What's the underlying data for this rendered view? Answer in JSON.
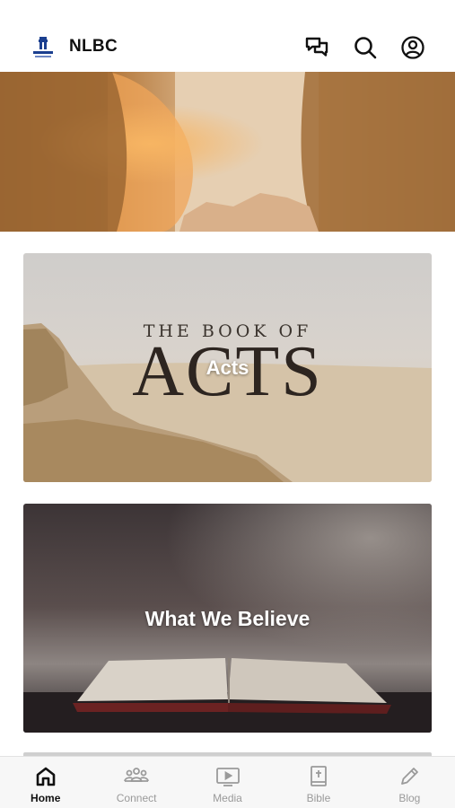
{
  "app": {
    "title": "NLBC",
    "logo_icon": "new-life-church-logo"
  },
  "header": {
    "actions": [
      {
        "name": "chat",
        "icon": "chat-bubbles-icon"
      },
      {
        "name": "search",
        "icon": "search-icon"
      },
      {
        "name": "account",
        "icon": "account-circle-icon"
      }
    ]
  },
  "cards": [
    {
      "label": "Acts",
      "artwork_line1": "THE BOOK OF",
      "artwork_line2": "ACTS"
    },
    {
      "label": "What We Believe"
    }
  ],
  "tabs": [
    {
      "label": "Home",
      "icon": "home-icon",
      "active": true
    },
    {
      "label": "Connect",
      "icon": "people-icon",
      "active": false
    },
    {
      "label": "Media",
      "icon": "media-play-icon",
      "active": false
    },
    {
      "label": "Bible",
      "icon": "bible-icon",
      "active": false
    },
    {
      "label": "Blog",
      "icon": "pencil-icon",
      "active": false
    }
  ],
  "colors": {
    "active_tab": "#111111",
    "inactive_tab": "#9a9a9a",
    "tab_bar_bg": "#f7f7f7"
  }
}
